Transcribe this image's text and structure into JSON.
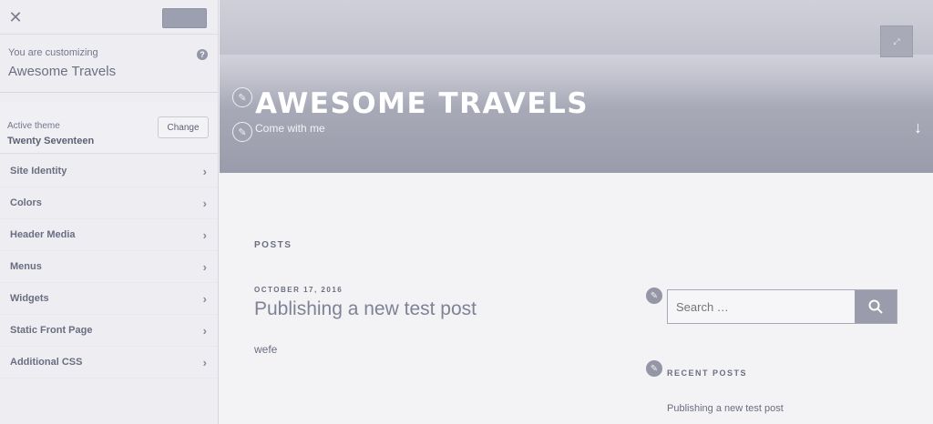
{
  "customizer": {
    "close_icon": "close-icon",
    "publish_label": "",
    "customizing_label": "You are customizing",
    "site_name": "Awesome Travels",
    "help_icon": "help-icon",
    "active_theme_label": "Active theme",
    "theme_name": "Twenty Seventeen",
    "change_label": "Change",
    "panels": [
      {
        "label": "Site Identity"
      },
      {
        "label": "Colors"
      },
      {
        "label": "Header Media"
      },
      {
        "label": "Menus"
      },
      {
        "label": "Widgets"
      },
      {
        "label": "Static Front Page"
      },
      {
        "label": "Additional CSS"
      }
    ]
  },
  "site": {
    "title": "AWESOME TRAVELS",
    "tagline": "Come with me",
    "scroll_icon": "arrow-down-icon"
  },
  "content": {
    "posts_heading": "POSTS",
    "post": {
      "date": "OCTOBER 17, 2016",
      "title": "Publishing a new test post",
      "excerpt": "wefe"
    }
  },
  "widgets": {
    "search_placeholder": "Search …",
    "search_icon": "search-icon",
    "recent_posts_heading": "RECENT POSTS",
    "recent_posts": [
      "Publishing a new test post"
    ]
  },
  "colors": {
    "header_bg": "#9a9cab",
    "sidebar_bg": "#eeeef2",
    "accent": "#9a9cab"
  }
}
